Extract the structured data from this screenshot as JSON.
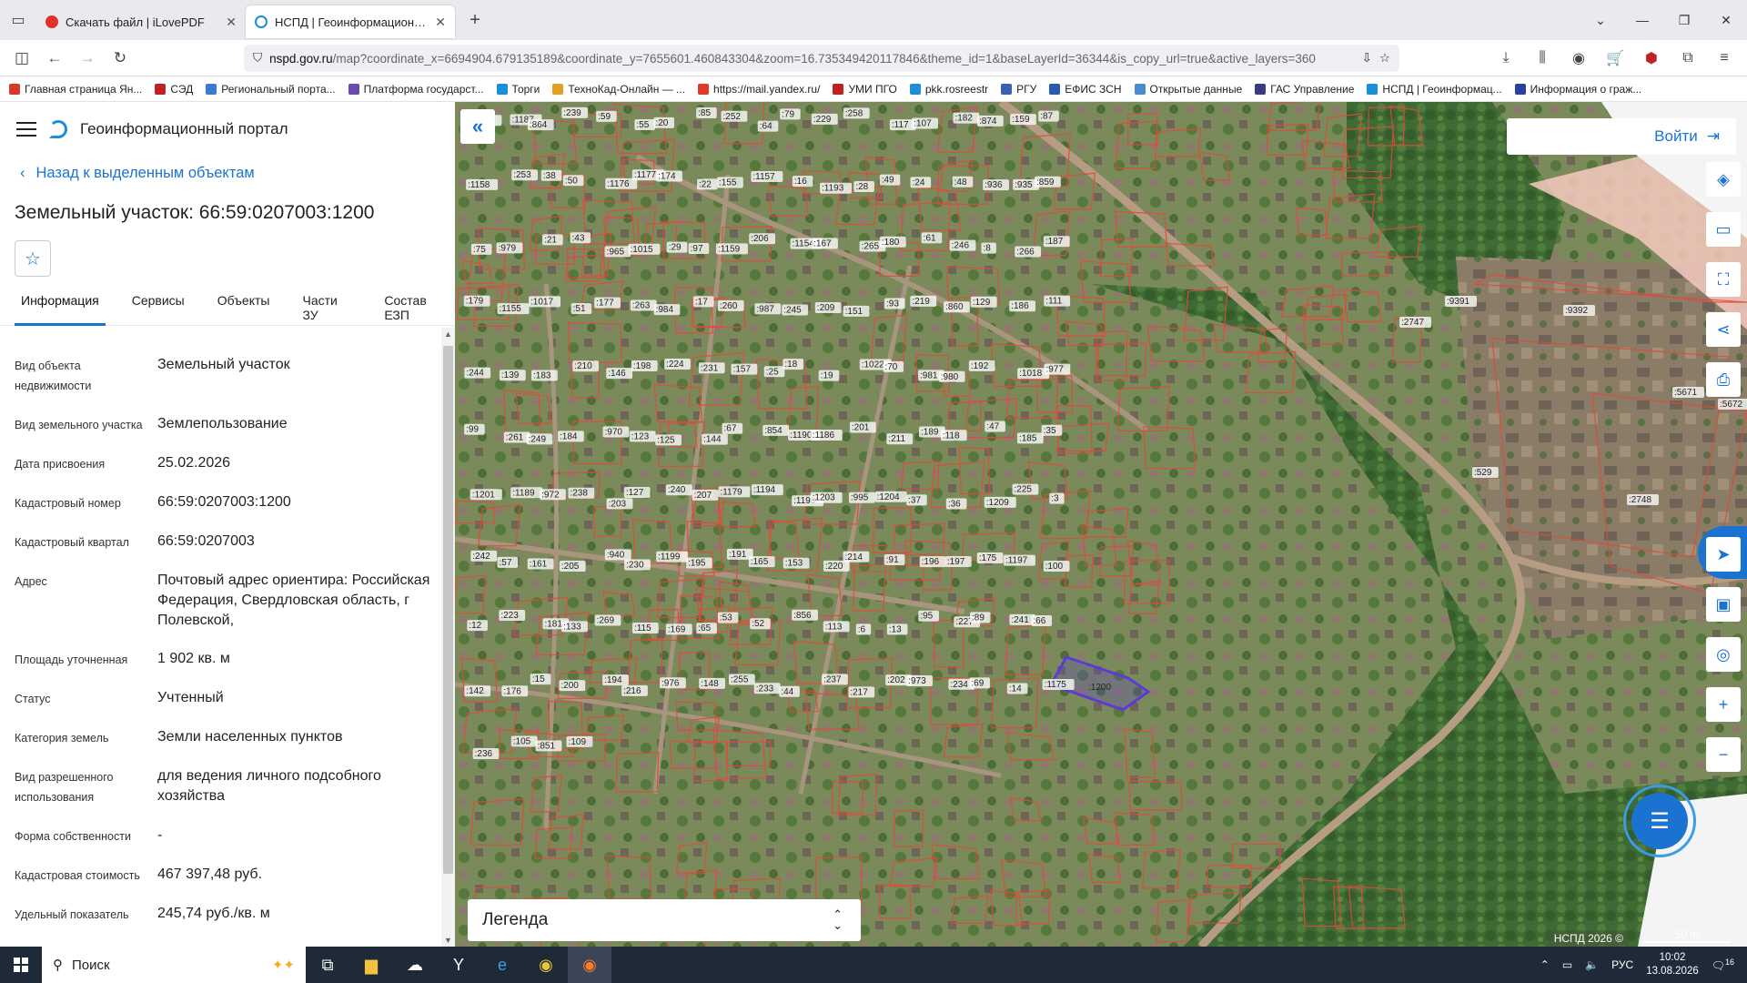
{
  "browser": {
    "tabs": [
      {
        "title": "Скачать файл | iLovePDF",
        "icon": "heart-icon",
        "active": false
      },
      {
        "title": "НСПД | Геоинформационный",
        "icon": "nspd-icon",
        "active": true
      }
    ],
    "url_host": "nspd.gov.ru",
    "url_path": "/map?coordinate_x=6694904.679135189&coordinate_y=7655601.460843304&zoom=16.735349420117846&theme_id=1&baseLayerId=36344&is_copy_url=true&active_layers=360",
    "bookmarks": [
      "Главная страница Ян...",
      "СЭД",
      "Региональный порта...",
      "Платформа государст...",
      "Торги",
      "ТехноКад-Онлайн — ...",
      "https://mail.yandex.ru/",
      "УМИ ПГО",
      "pkk.rosreestr",
      "РГУ",
      "ЕФИС ЗСН",
      "Открытые данные",
      "ГАС Управление",
      "НСПД | Геоинформац...",
      "Информация о граж..."
    ]
  },
  "panel": {
    "portal_title": "Геоинформационный портал",
    "back_label": "Назад к выделенным объектам",
    "object_title": "Земельный участок: 66:59:0207003:1200",
    "tabs": [
      "Информация",
      "Сервисы",
      "Объекты",
      "Части ЗУ",
      "Состав ЕЗП"
    ],
    "properties": [
      {
        "label": "Вид объекта недвижимости",
        "value": "Земельный участок"
      },
      {
        "label": "Вид земельного участка",
        "value": "Землепользование"
      },
      {
        "label": "Дата присвоения",
        "value": "25.02.2026"
      },
      {
        "label": "Кадастровый номер",
        "value": "66:59:0207003:1200"
      },
      {
        "label": "Кадастровый квартал",
        "value": "66:59:0207003"
      },
      {
        "label": "Адрес",
        "value": "Почтовый адрес ориентира: Российская Федерация, Свердловская область, г Полевской,"
      },
      {
        "label": "Площадь уточненная",
        "value": "1 902 кв. м"
      },
      {
        "label": "Статус",
        "value": "Учтенный"
      },
      {
        "label": "Категория земель",
        "value": "Земли населенных пунктов"
      },
      {
        "label": "Вид разрешенного использования",
        "value": "для ведения личного подсобного хозяйства"
      },
      {
        "label": "Форма собственности",
        "value": "-"
      },
      {
        "label": "Кадастровая стоимость",
        "value": "467 397,48 руб."
      },
      {
        "label": "Удельный показатель",
        "value": "245,74 руб./кв. м"
      }
    ]
  },
  "map": {
    "login_label": "Войти",
    "legend_label": "Легенда",
    "copyright": "НСПД 2026 ©",
    "scale": "50 m",
    "selected_parcel": ":1200",
    "parcel_labels": [
      ":982",
      ":1187",
      ":864",
      ":239",
      ":59",
      ":55",
      ":20",
      ":85",
      ":252",
      ":64",
      ":79",
      ":229",
      ":258",
      ":117",
      ":107",
      ":182",
      ":874",
      ":159",
      ":87",
      ":1158",
      ":253",
      ":38",
      ":50",
      ":1176",
      ":1177",
      ":174",
      ":22",
      ":155",
      ":1157",
      ":16",
      ":1193",
      ":28",
      ":49",
      ":24",
      ":48",
      ":936",
      ":935",
      ":859",
      ":75",
      ":979",
      ":21",
      ":43",
      ":965",
      ":1015",
      ":29",
      ":97",
      ":1159",
      ":206",
      ":1154",
      ":167",
      ":265",
      ":180",
      ":61",
      ":246",
      ":8",
      ":266",
      ":187",
      ":179",
      ":1155",
      ":1017",
      ":51",
      ":177",
      ":263",
      ":984",
      ":17",
      ":260",
      ":987",
      ":245",
      ":209",
      ":151",
      ":93",
      ":219",
      ":860",
      ":129",
      ":186",
      ":111",
      ":244",
      ":139",
      ":183",
      ":210",
      ":146",
      ":198",
      ":224",
      ":231",
      ":157",
      ":25",
      ":18",
      ":19",
      ":1022",
      ":70",
      ":981",
      ":980",
      ":192",
      ":1018",
      ":977",
      ":99",
      ":261",
      ":249",
      ":184",
      ":970",
      ":123",
      ":125",
      ":144",
      ":67",
      ":854",
      ":1190",
      ":1186",
      ":201",
      ":211",
      ":189",
      ":118",
      ":47",
      ":185",
      ":35",
      ":1201",
      ":1189",
      ":972",
      ":238",
      ":203",
      ":127",
      ":240",
      ":207",
      ":1179",
      ":1194",
      ":1198",
      ":1203",
      ":995",
      ":1204",
      ":37",
      ":36",
      ":1209",
      ":225",
      ":3",
      ":242",
      ":57",
      ":161",
      ":205",
      ":940",
      ":230",
      ":1199",
      ":195",
      ":191",
      ":165",
      ":153",
      ":220",
      ":214",
      ":91",
      ":196",
      ":197",
      ":175",
      ":1197",
      ":100",
      ":12",
      ":223",
      ":181",
      ":133",
      ":269",
      ":115",
      ":169",
      ":65",
      ":53",
      ":52",
      ":856",
      ":113",
      ":6",
      ":13",
      ":95",
      ":227",
      ":89",
      ":241",
      ":66",
      ":142",
      ":176",
      ":15",
      ":200",
      ":194",
      ":216",
      ":976",
      ":148",
      ":255",
      ":233",
      ":44",
      ":237",
      ":217",
      ":202",
      ":973",
      ":234",
      ":69",
      ":14",
      ":1175",
      ":236",
      ":105",
      ":851",
      ":109",
      ":9391",
      ":9392",
      ":2747",
      ":5671",
      ":5672",
      ":529",
      ":2748"
    ]
  },
  "taskbar": {
    "search_placeholder": "Поиск",
    "lang": "РУС",
    "time": "10:02",
    "date": "13.08.2026",
    "notif_count": "16"
  },
  "colors": {
    "accent": "#1a73d0",
    "parcel_border": "#e04a3a",
    "selected_parcel": "#5a3bd6",
    "taskbar": "#1f2a38"
  }
}
